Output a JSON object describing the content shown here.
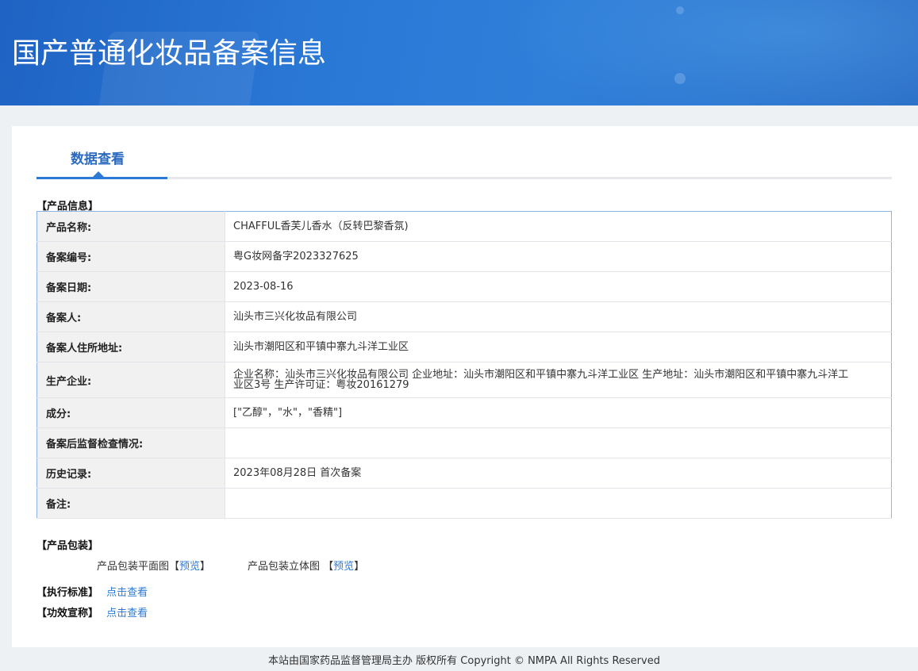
{
  "header": {
    "title": "国产普通化妆品备案信息"
  },
  "tabs": [
    {
      "label": "数据查看",
      "active": true
    }
  ],
  "product_info": {
    "section_label": "【产品信息】",
    "rows": [
      {
        "label": "产品名称:",
        "value": "CHAFFUL香芙儿香水（反转巴黎香氛)"
      },
      {
        "label": "备案编号:",
        "value": "粤G妆网备字2023327625"
      },
      {
        "label": "备案日期:",
        "value": "2023-08-16"
      },
      {
        "label": "备案人:",
        "value": "汕头市三兴化妆品有限公司"
      },
      {
        "label": "备案人住所地址:",
        "value": "汕头市潮阳区和平镇中寨九斗洋工业区"
      },
      {
        "label": "生产企业:",
        "value": "企业名称：汕头市三兴化妆品有限公司 企业地址：汕头市潮阳区和平镇中寨九斗洋工业区 生产地址：汕头市潮阳区和平镇中寨九斗洋工业区3号 生产许可证：粤妆20161279"
      },
      {
        "label": "成分:",
        "value": "[\"乙醇\"，\"水\"，\"香精\"]"
      },
      {
        "label": "备案后监督检查情况:",
        "value": ""
      },
      {
        "label": "历史记录:",
        "value": "2023年08月28日 首次备案"
      },
      {
        "label": "备注:",
        "value": ""
      }
    ]
  },
  "packaging": {
    "section_label": "【产品包装】",
    "flat_label": "产品包装平面图",
    "flat_open": "【",
    "flat_link": "预览",
    "flat_close": "】",
    "stereo_label": "产品包装立体图",
    "stereo_open": "【",
    "stereo_link": "预览",
    "stereo_close": "】"
  },
  "standard": {
    "label": "【执行标准】",
    "link": "点击查看"
  },
  "efficacy": {
    "label": "【功效宣称】",
    "link": "点击查看"
  },
  "footer": {
    "text": "本站由国家药品监督管理局主办 版权所有 Copyright © NMPA All Rights Reserved"
  },
  "colors": {
    "banner": "#2a78d6",
    "accent": "#2c7ad6",
    "table_border": "#8fb4e3"
  }
}
